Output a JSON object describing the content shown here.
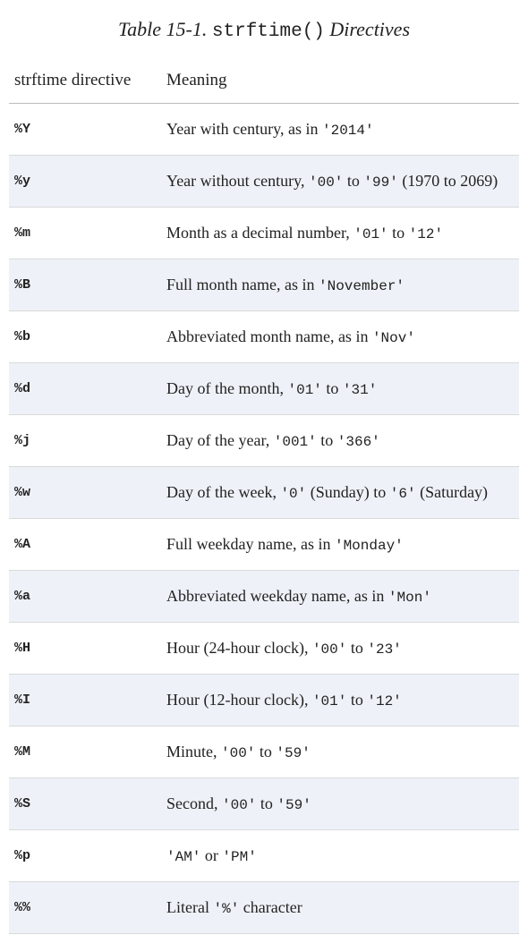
{
  "title": {
    "prefix": "Table 15-1. ",
    "code": "strftime()",
    "suffix": " Directives"
  },
  "headers": {
    "directive": "strftime directive",
    "meaning": "Meaning"
  },
  "rows": [
    {
      "directive": "%Y",
      "meaning_html": "Year with century, as in <code>'2014'</code>"
    },
    {
      "directive": "%y",
      "meaning_html": "Year without century, <code>'00'</code> to <code>'99'</code> (1970 to 2069)"
    },
    {
      "directive": "%m",
      "meaning_html": "Month as a decimal number, <code>'01'</code> to <code>'12'</code>"
    },
    {
      "directive": "%B",
      "meaning_html": "Full month name, as in <code>'November'</code>"
    },
    {
      "directive": "%b",
      "meaning_html": "Abbreviated month name, as in <code>'Nov'</code>"
    },
    {
      "directive": "%d",
      "meaning_html": "Day of the month, <code>'01'</code> to <code>'31'</code>"
    },
    {
      "directive": "%j",
      "meaning_html": "Day of the year, <code>'001'</code> to <code>'366'</code>"
    },
    {
      "directive": "%w",
      "meaning_html": "Day of the week, <code>'0'</code> (Sunday) to <code>'6'</code> (Saturday)"
    },
    {
      "directive": "%A",
      "meaning_html": "Full weekday name, as in <code>'Monday'</code>"
    },
    {
      "directive": "%a",
      "meaning_html": "Abbreviated weekday name, as in <code>'Mon'</code>"
    },
    {
      "directive": "%H",
      "meaning_html": "Hour (24-hour clock), <code>'00'</code> to <code>'23'</code>"
    },
    {
      "directive": "%I",
      "meaning_html": "Hour (12-hour clock), <code>'01'</code> to <code>'12'</code>"
    },
    {
      "directive": "%M",
      "meaning_html": "Minute, <code>'00'</code> to <code>'59'</code>"
    },
    {
      "directive": "%S",
      "meaning_html": "Second, <code>'00'</code> to <code>'59'</code>"
    },
    {
      "directive": "%p",
      "meaning_html": "<code>'AM'</code> or <code>'PM'</code>"
    },
    {
      "directive": "%%",
      "meaning_html": "Literal <code>'%'</code> character"
    }
  ]
}
